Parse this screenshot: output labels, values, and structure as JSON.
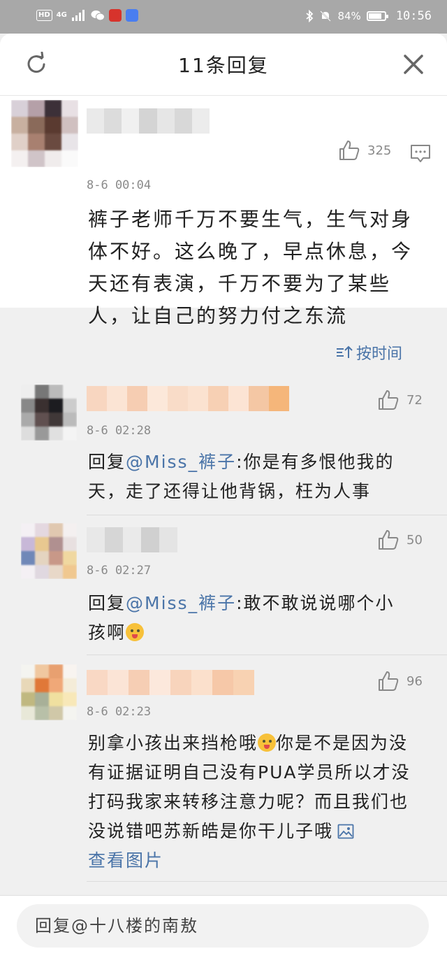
{
  "status_bar": {
    "network_hd": "HD",
    "network_4g": "4G",
    "battery_text": "84%",
    "battery_level": 0.84,
    "time": "10:56"
  },
  "header": {
    "title": "11条回复",
    "refresh_icon": "refresh-icon",
    "close_icon": "close-icon"
  },
  "main_comment": {
    "time": "8-6 00:04",
    "likes": "325",
    "text": "裤子老师千万不要生气，生气对身体不好。这么晚了，早点休息，今天还有表演，千万不要为了某些人，让自己的努力付之东流"
  },
  "sort": {
    "label": "按时间"
  },
  "replies": [
    {
      "time": "8-6 02:28",
      "likes": "72",
      "prefix": "回复",
      "mention": "@Miss_裤子",
      "text": ":你是有多恨他我的天，走了还得让他背锅，枉为人事"
    },
    {
      "time": "8-6 02:27",
      "likes": "50",
      "prefix": "回复",
      "mention": "@Miss_裤子",
      "text": ":敢不敢说说哪个小孩啊"
    },
    {
      "time": "8-6 02:23",
      "likes": "96",
      "text_before_emoji": "别拿小孩出来挡枪哦",
      "text_after_emoji": "你是不是因为没有证据证明自己没有PUA学员所以才没打码我家来转移注意力呢？而且我们也没说错吧苏新皓是你干儿子哦",
      "image_link": "查看图片"
    }
  ],
  "bottom": {
    "placeholder": "回复@十八楼的南敖"
  },
  "colors": {
    "accent": "#4a74a8",
    "status_bar": "#a8a8a8"
  }
}
